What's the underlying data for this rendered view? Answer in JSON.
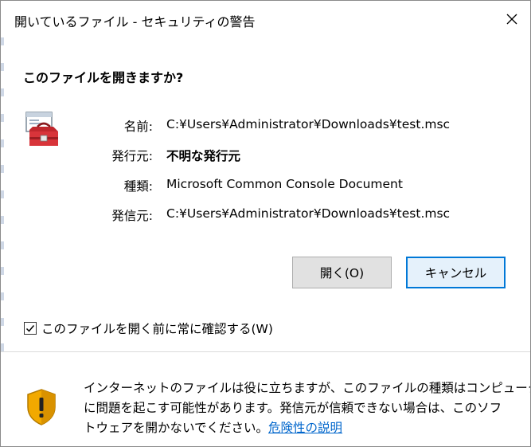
{
  "window": {
    "title": "開いているファイル - セキュリティの警告",
    "close_icon": "close-icon"
  },
  "dialog": {
    "question": "このファイルを開きますか?",
    "app_icon": "toolbox-icon",
    "fields": [
      {
        "label": "名前:",
        "value": "C:¥Users¥Administrator¥Downloads¥test.msc"
      },
      {
        "label": "発行元:",
        "value": "不明な発行元"
      },
      {
        "label": "種類:",
        "value": "Microsoft Common Console Document"
      },
      {
        "label": "発信元:",
        "value": "C:¥Users¥Administrator¥Downloads¥test.msc"
      }
    ],
    "open_button": "開く(O)",
    "cancel_button": "キャンセル",
    "checkbox_label": "このファイルを開く前に常に確認する(W)",
    "checkbox_checked": true
  },
  "footer": {
    "warning_icon": "shield-warning-icon",
    "line1": "インターネットのファイルは役に立ちますが、このファイルの種類はコンピューター",
    "line2": "に問題を起こす可能性があります。発信元が信頼できない場合は、このソフ",
    "line3_prefix": "トウェアを開かないでください。",
    "link": "危険性の説明"
  },
  "colors": {
    "link": "#0066cc",
    "default_button_border": "#0078d7",
    "warning_shield": "#f2a900"
  }
}
